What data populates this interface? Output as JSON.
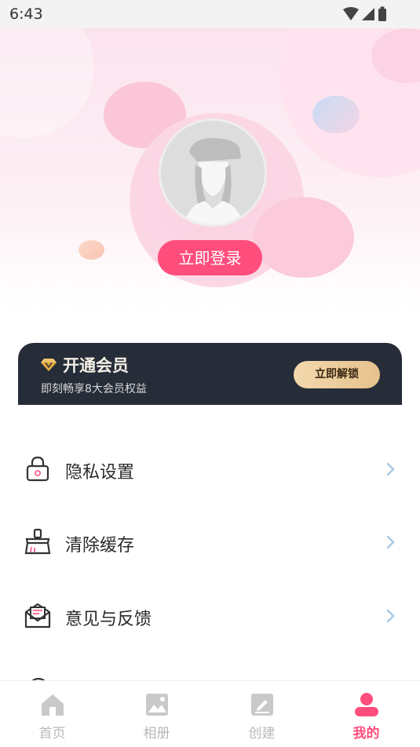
{
  "status_bar": {
    "time": "6:43"
  },
  "hero": {
    "login_button": "立即登录"
  },
  "vip": {
    "title": "开通会员",
    "subtitle": "即刻畅享8大会员权益",
    "button": "立即解锁"
  },
  "menu": [
    {
      "label": "隐私设置",
      "icon": "lock-icon"
    },
    {
      "label": "清除缓存",
      "icon": "broom-icon"
    },
    {
      "label": "意见与反馈",
      "icon": "mail-icon"
    }
  ],
  "tabs": [
    {
      "label": "首页",
      "icon": "home-icon",
      "active": false
    },
    {
      "label": "相册",
      "icon": "image-icon",
      "active": false
    },
    {
      "label": "创建",
      "icon": "create-icon",
      "active": false
    },
    {
      "label": "我的",
      "icon": "user-icon",
      "active": true
    }
  ],
  "colors": {
    "accent": "#ff4d7c",
    "vip_bg": "#262d39",
    "vip_button": "#e6c28d",
    "arrow": "#a9cbe8"
  }
}
